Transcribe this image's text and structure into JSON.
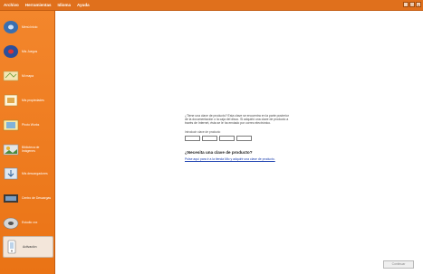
{
  "menubar": {
    "items": [
      {
        "label": "Archivo"
      },
      {
        "label": "Herramientas"
      },
      {
        "label": "Idioma"
      },
      {
        "label": "Ayuda"
      }
    ],
    "window_buttons": {
      "minimize": "_",
      "maximize": "□",
      "close": "x"
    }
  },
  "sidebar": {
    "items": [
      {
        "label": "Menú Inicio",
        "icon": "home-disc-icon"
      },
      {
        "label": "Mis Juegos",
        "icon": "games-disc-icon"
      },
      {
        "label": "Mi mapa",
        "icon": "map-icon"
      },
      {
        "label": "Mis propiedades",
        "icon": "properties-icon"
      },
      {
        "label": "Photo Works",
        "icon": "photo-icon"
      },
      {
        "label": "Biblioteca de Imágenes",
        "icon": "image-library-icon"
      },
      {
        "label": "Mis descargadores",
        "icon": "downloads-icon"
      },
      {
        "label": "Centro de Descargas",
        "icon": "download-center-icon"
      },
      {
        "label": "Estudio xxx",
        "icon": "studio-icon"
      },
      {
        "label": "Activación",
        "icon": "activation-icon",
        "selected": true
      }
    ]
  },
  "activation": {
    "intro": "¿Tiene una clave de producto? Esta clave se encuentra en la parte posterior de la documentación o la caja del disco. Si adquirió una clave de producto a través de Internet, ésta se le ha enviado por correo electrónico.",
    "key_label": "Introducir clave de producto",
    "need_title": "¿Necesita una clave de producto?",
    "need_link": "Pulse aquí para ir a la tienda Mio y adquirir una clave de producto."
  },
  "footer": {
    "continue_label": "Continuar",
    "status_text": ""
  },
  "colors": {
    "accent": "#ea7315",
    "link": "#1b3fb0"
  }
}
